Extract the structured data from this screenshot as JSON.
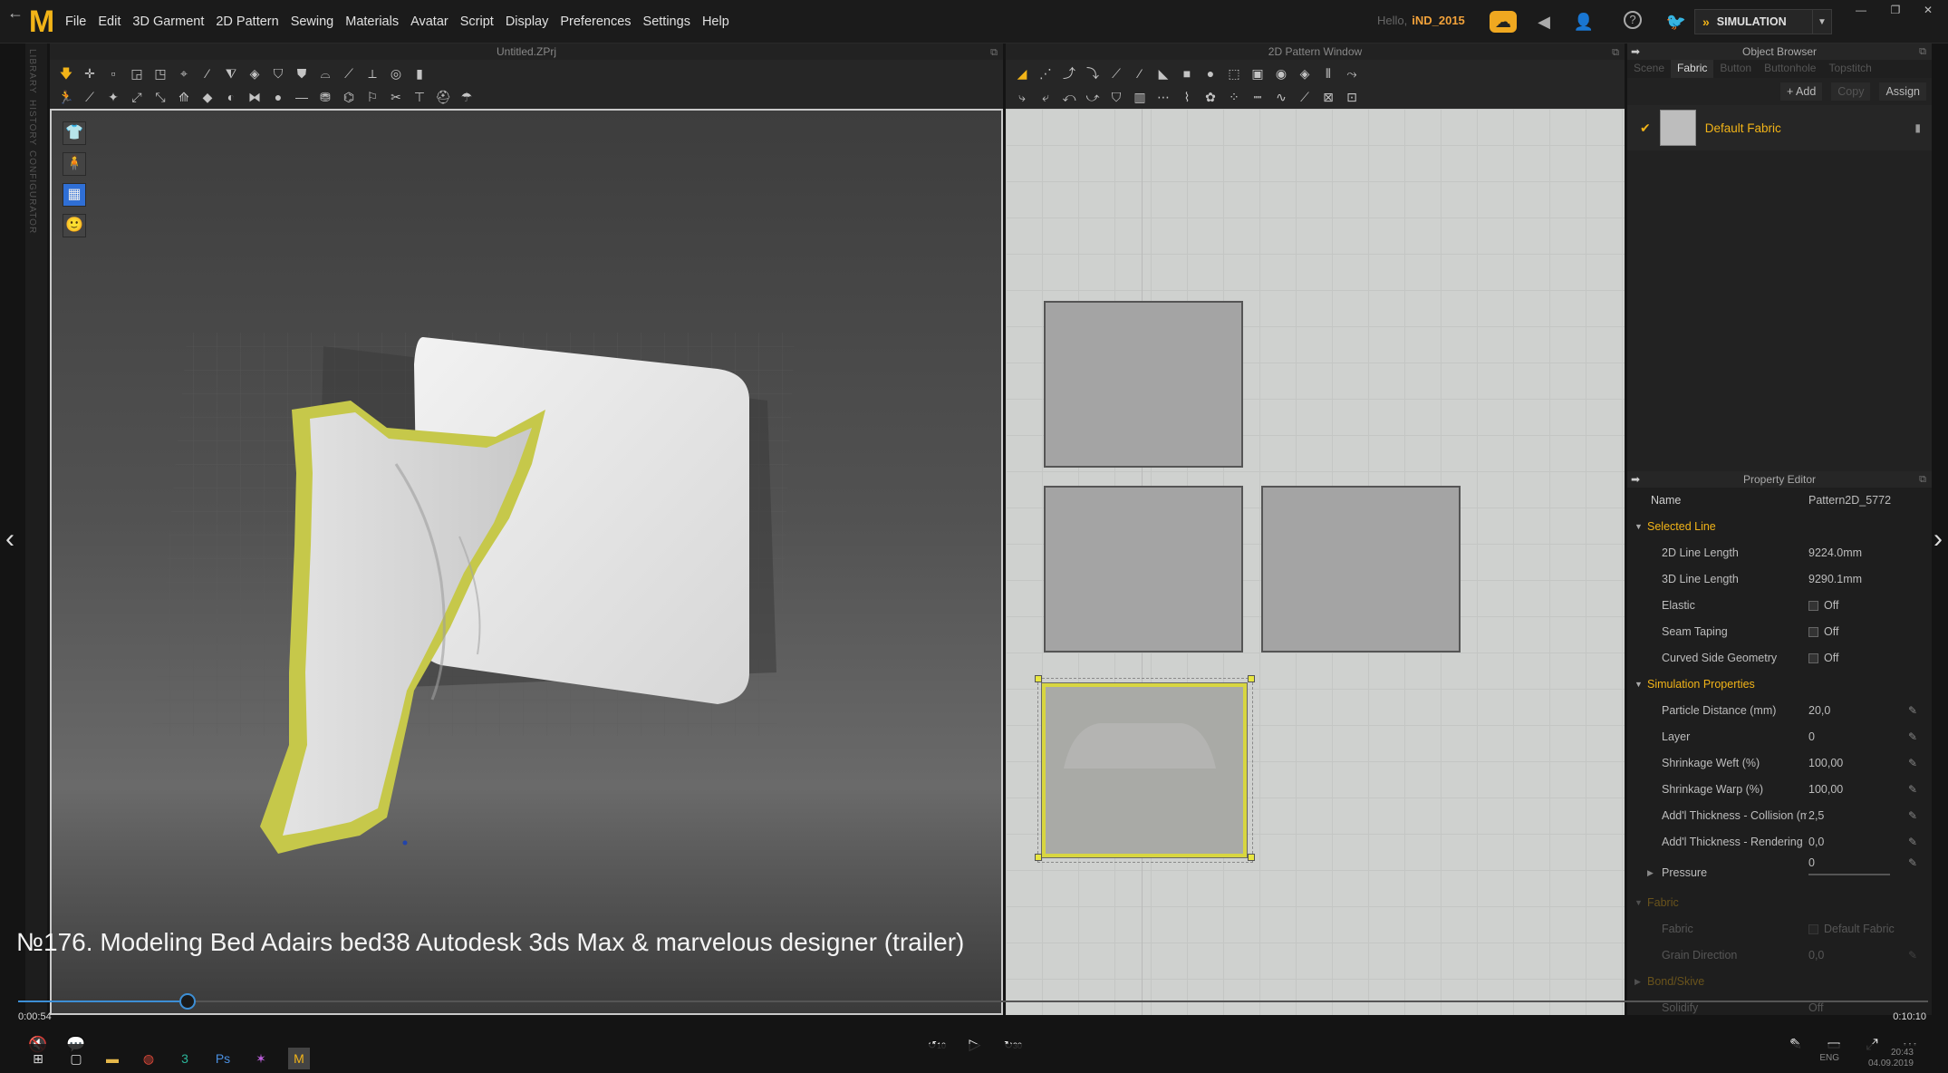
{
  "app": {
    "logo": "M",
    "menus": [
      "File",
      "Edit",
      "3D Garment",
      "2D Pattern",
      "Sewing",
      "Materials",
      "Avatar",
      "Script",
      "Display",
      "Preferences",
      "Settings",
      "Help"
    ],
    "hello_label": "Hello,",
    "user": "iND_2015",
    "mode": "SIMULATION"
  },
  "left_strip": {
    "tabs": [
      "LIBRARY",
      "HISTORY",
      "CONFIGURATOR"
    ]
  },
  "window3d": {
    "title": "Untitled.ZPrj"
  },
  "window2d": {
    "title": "2D Pattern Window"
  },
  "object_browser": {
    "title": "Object Browser",
    "tabs": [
      "Scene",
      "Fabric",
      "Button",
      "Buttonhole",
      "Topstitch"
    ],
    "active_tab": "Fabric",
    "actions": {
      "add": "+ Add",
      "copy": "Copy",
      "assign": "Assign"
    },
    "fabric_name": "Default Fabric"
  },
  "property_editor": {
    "title": "Property Editor",
    "name_label": "Name",
    "name_value": "Pattern2D_5772",
    "section_selected_line": "Selected Line",
    "line_2d_label": "2D Line Length",
    "line_2d_value": "9224.0mm",
    "line_3d_label": "3D Line Length",
    "line_3d_value": "9290.1mm",
    "elastic_label": "Elastic",
    "elastic_value": "Off",
    "seam_label": "Seam Taping",
    "seam_value": "Off",
    "curved_label": "Curved Side Geometry",
    "curved_value": "Off",
    "section_sim": "Simulation Properties",
    "particle_label": "Particle Distance (mm)",
    "particle_value": "20,0",
    "layer_label": "Layer",
    "layer_value": "0",
    "weft_label": "Shrinkage Weft (%)",
    "weft_value": "100,00",
    "warp_label": "Shrinkage Warp (%)",
    "warp_value": "100,00",
    "thick_col_label": "Add'l Thickness - Collision (m",
    "thick_col_value": "2,5",
    "thick_ren_label": "Add'l Thickness - Rendering (r",
    "thick_ren_value": "0,0",
    "pressure_value": "0",
    "pressure_label": "Pressure",
    "section_fabric": "Fabric",
    "fabric_label": "Fabric",
    "fabric_value": "Default Fabric",
    "grain_label": "Grain Direction",
    "grain_value": "0,0",
    "section_bond": "Bond/Skive",
    "solidify_label": "Solidify",
    "solidify_value": "Off"
  },
  "video": {
    "title": "№176. Modeling Bed  Adairs bed38  Autodesk 3ds Max & marvelous designer (trailer)",
    "elapsed": "0:00:54",
    "total": "0:10:10",
    "progress_fraction": 0.0885,
    "rewind_label": "10",
    "forward_label": "30"
  },
  "taskbar": {
    "lang": "ENG",
    "time": "20:43",
    "date": "04.09.2019"
  },
  "colors": {
    "accent": "#f2b418",
    "selection": "#d8d640",
    "progress": "#3d8fd6"
  }
}
